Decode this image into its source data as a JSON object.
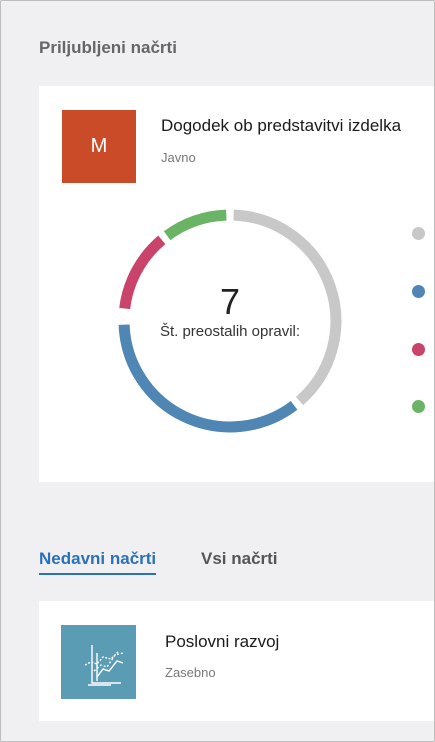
{
  "favorites": {
    "section_title": "Priljubljeni načrti",
    "plan": {
      "tile_letter": "M",
      "tile_color": "#c94b27",
      "name": "Dogodek ob predstavitvi izdelka",
      "visibility": "Javno",
      "remaining_count": "7",
      "remaining_label": "Št. preostalih opravil:",
      "status_colors": {
        "not_started": "#c8c8c8",
        "in_progress": "#4f86b4",
        "late": "#c9436a",
        "completed": "#6bb466"
      }
    }
  },
  "tabs": {
    "recent": "Nedavni načrti",
    "all": "Vsi načrti"
  },
  "recent": {
    "items": [
      {
        "name": "Poslovni razvoj",
        "visibility": "Zasebno",
        "tile_color": "#5b9cb5",
        "icon": "line-chart-icon"
      }
    ]
  }
}
